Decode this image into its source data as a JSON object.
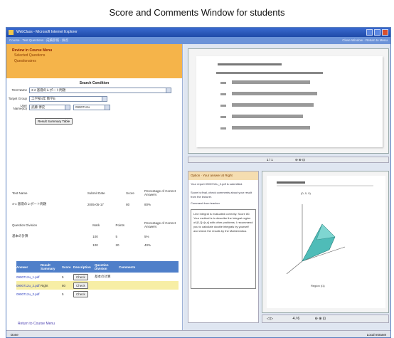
{
  "caption": "Score and Comments Window for students",
  "review": {
    "title": "Review in Course Menu",
    "links": [
      "Selected Questions",
      "Questionaires"
    ]
  },
  "search": {
    "title": "Search Condition",
    "test_name_label": "Test Name",
    "test_name_value": "3-2 基礎のレポート問題",
    "target_group_label": "Target Group",
    "target_group_value": "工学部4年 数学B",
    "user_name_label": "User Name(ID)",
    "user_name_value": "武藤 博史",
    "user_id_value": "0900712u",
    "button": "Result Summary Table"
  },
  "summary_table": {
    "headers": [
      "Test Name",
      "Submit Date",
      "Score",
      "Percentage of Correct Answers"
    ],
    "row": [
      "4-1 基礎のレポート問題",
      "2005-05-17",
      "80",
      "80%"
    ]
  },
  "division_table": {
    "headers": [
      "Question Division",
      "Mark",
      "Points",
      "Percentage of Correct Answers"
    ],
    "rows": [
      [
        "基本の計算",
        "100",
        "5",
        "5%"
      ],
      [
        "",
        "100",
        "20",
        "40%"
      ]
    ]
  },
  "answer_table": {
    "headers": [
      "Answer",
      "Result Summary",
      "Score",
      "Description",
      "Question Division",
      "Comments"
    ],
    "rows": [
      {
        "answer": "0900712u_1.pdf",
        "summary": "",
        "score": "5",
        "desc": "Check",
        "division": "基本の計算",
        "comments": ""
      },
      {
        "answer": "0900712u_2.pdf",
        "summary": "Right",
        "score": "80",
        "desc": "Check",
        "division": "",
        "comments": ""
      },
      {
        "answer": "0900712u_3.pdf",
        "summary": "",
        "score": "5",
        "desc": "Check",
        "division": "",
        "comments": ""
      }
    ]
  },
  "return_link": "Return to Course Menu",
  "option_panel": {
    "head": "Option · Your answer at Right",
    "text1": "Your report 0900712u_2.pdf is submitted.",
    "text2": "Score is final, check comments about your result from the lecturer.",
    "comment_title": "Comment from teacher",
    "comment": "Line integral is evaluated correctly. Score 80. Your method is to describe the integral region of [0,1]×[x,x] with other problems. I recommend you to calculate double integrals by yourself and check the results by the Mathematica."
  },
  "pdf_page_top": "1 / 1",
  "pdf_page_bottom": "4 / 6",
  "plot_caption": "Region (i1)",
  "plot_label": "(0, 0, 0)",
  "statusbar": {
    "left": "Done",
    "right": "Local Intranet"
  },
  "menubar": {
    "left": "Course · Test Questions · 成績参照 · 採点",
    "right": "Close Window · Return to Menu"
  },
  "titlebar": "WebClass - Microsoft Internet Explorer"
}
